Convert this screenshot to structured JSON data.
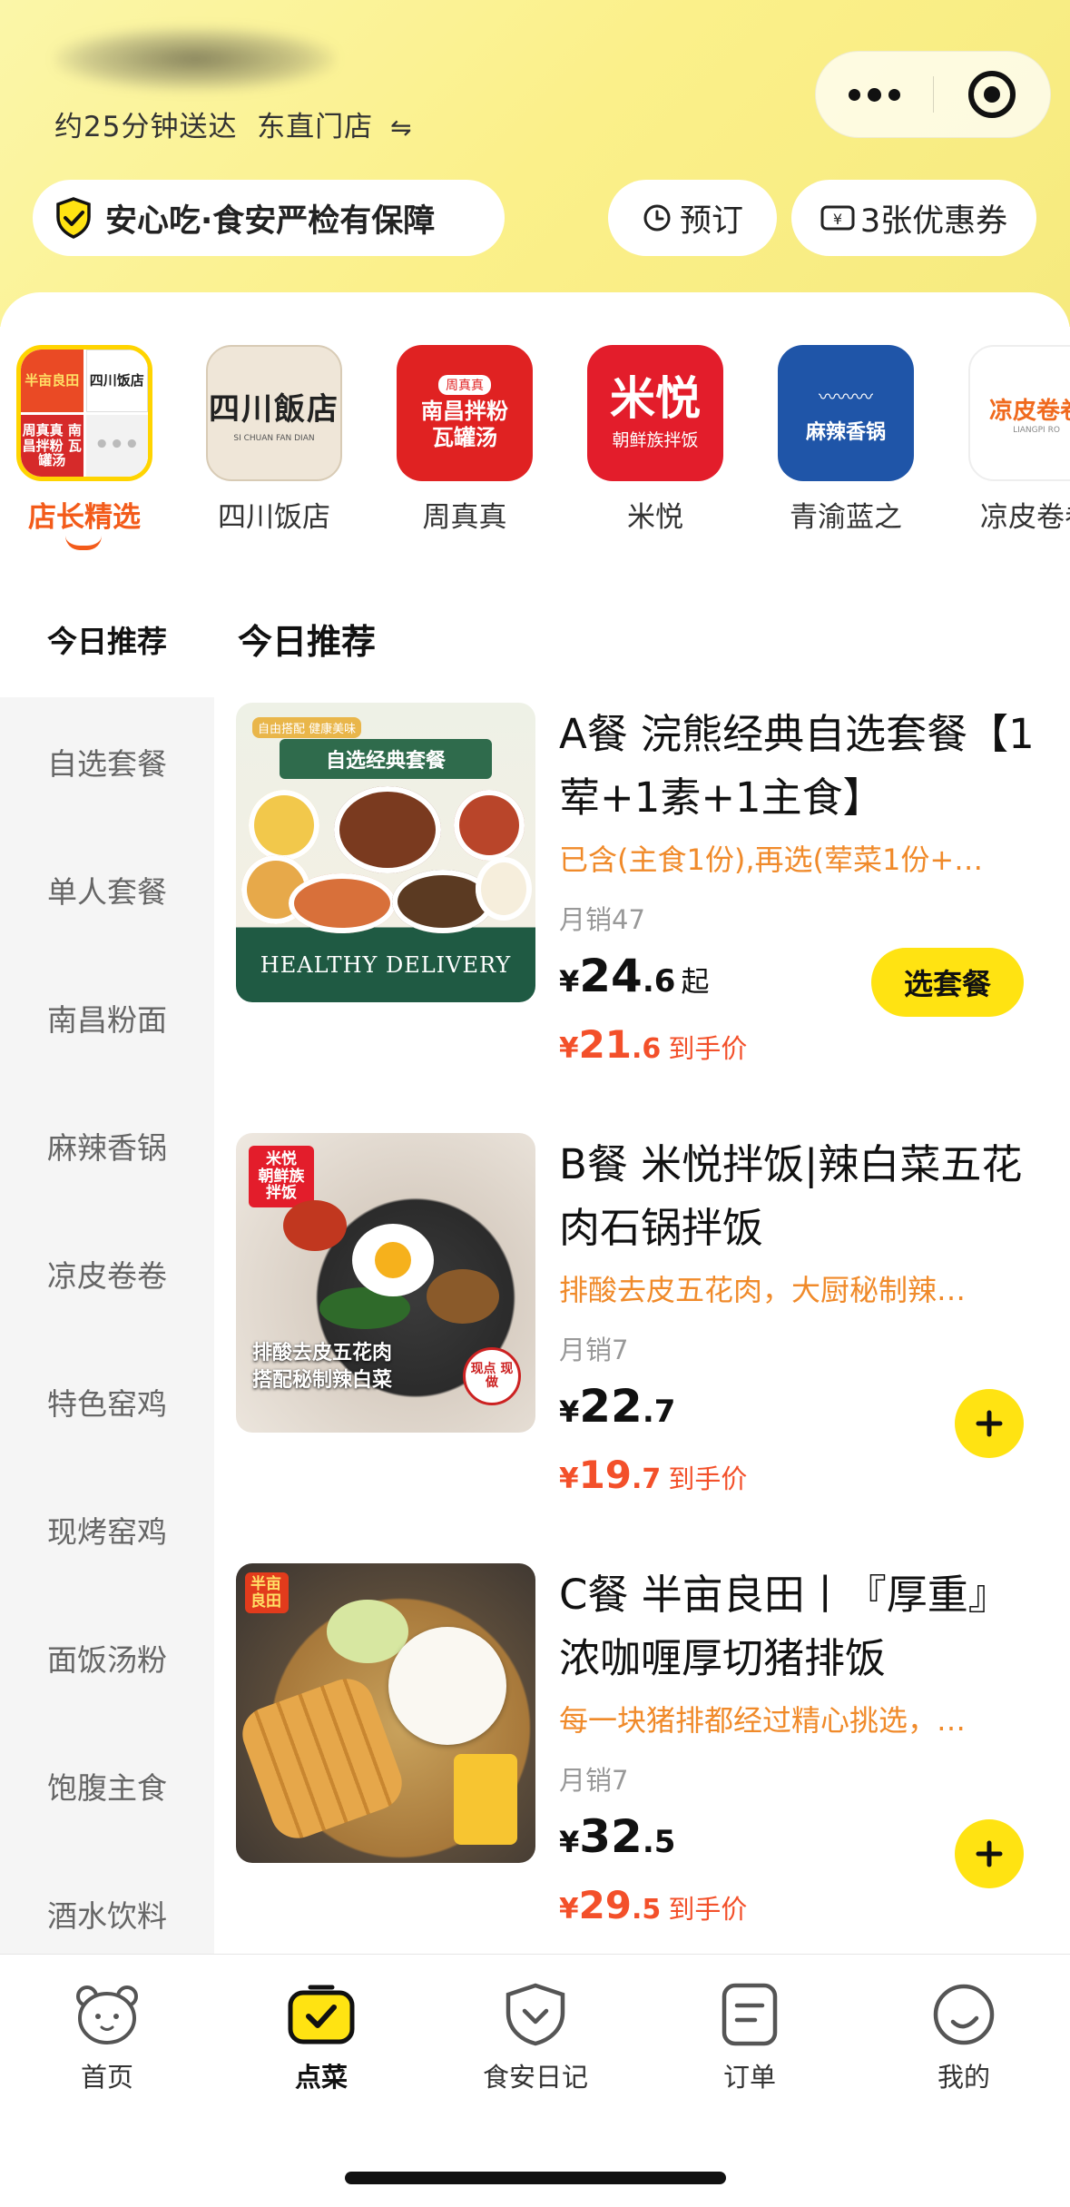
{
  "header": {
    "delivery_info": "约25分钟送达",
    "store_name": "东直门店",
    "switch_symbol": "⇋",
    "safety_label": "安心吃·食安严检有保障",
    "reserve_label": "预订",
    "coupon_label": "3张优惠券"
  },
  "stores": [
    {
      "name": "店长精选",
      "active": true,
      "logo_texts": [
        "半亩良田",
        "四川饭店",
        "周真真 南昌拌粉 瓦罐汤",
        "•••"
      ]
    },
    {
      "name": "四川饭店",
      "logo_main": "四川飯店",
      "logo_sub": "SI CHUAN FAN DIAN"
    },
    {
      "name": "周真真",
      "logo_top": "周真真",
      "logo_main": "南昌拌粉 瓦罐汤"
    },
    {
      "name": "米悦",
      "logo_main": "米悦",
      "logo_sub": "朝鲜族拌饭"
    },
    {
      "name": "青渝蓝之",
      "logo_main": "麻辣香锅"
    },
    {
      "name": "凉皮卷卷",
      "logo_main": "凉皮卷卷",
      "logo_sub": "LIANGPI RO"
    }
  ],
  "sidebar": {
    "active": "今日推荐",
    "categories": [
      "自选套餐",
      "单人套餐",
      "南昌粉面",
      "麻辣香锅",
      "凉皮卷卷",
      "特色窑鸡",
      "现烤窑鸡",
      "面饭汤粉",
      "饱腹主食",
      "酒水饮料"
    ]
  },
  "section_title": "今日推荐",
  "dishes": [
    {
      "title": "A餐 浣熊经典自选套餐【1荤+1素+1主食】",
      "desc": "已含(主食1份),再选(荤菜1份+…",
      "sales": "月销47",
      "price_yen": "¥",
      "price_int": "24",
      "price_dec": ".6",
      "price_suffix": "起",
      "final_yen": "¥",
      "final_int": "21",
      "final_dec": ".6",
      "final_tag": "到手价",
      "action": "选套餐",
      "img_texts": {
        "mini": "自由搭配 健康美味",
        "banner": "自选经典套餐",
        "foot": "HEALTHY DELIVERY"
      }
    },
    {
      "title": "B餐 米悦拌饭|辣白菜五花肉石锅拌饭",
      "desc": "排酸去皮五花肉，大厨秘制辣…",
      "sales": "月销7",
      "price_yen": "¥",
      "price_int": "22",
      "price_dec": ".7",
      "final_yen": "¥",
      "final_int": "19",
      "final_dec": ".7",
      "final_tag": "到手价",
      "img_texts": {
        "brand": "米悦 朝鲜族拌饭",
        "cap1": "排酸去皮五花肉",
        "cap2": "搭配秘制辣白菜",
        "stamp": "现点 现做"
      }
    },
    {
      "title": "C餐 半亩良田丨『厚重』浓咖喱厚切猪排饭",
      "desc": "每一块猪排都经过精心挑选，…",
      "sales": "月销7",
      "price_yen": "¥",
      "price_int": "32",
      "price_dec": ".5",
      "final_yen": "¥",
      "final_int": "29",
      "final_dec": ".5",
      "final_tag": "到手价",
      "img_texts": {
        "brand": "半亩 良田"
      }
    }
  ],
  "bottom_nav": [
    {
      "label": "首页",
      "icon": "bear-face-icon"
    },
    {
      "label": "点菜",
      "icon": "order-food-icon",
      "active": true
    },
    {
      "label": "食安日记",
      "icon": "shield-check-icon"
    },
    {
      "label": "订单",
      "icon": "order-list-icon"
    },
    {
      "label": "我的",
      "icon": "profile-smile-icon"
    }
  ],
  "colors": {
    "accent_yellow": "#ffe312",
    "accent_orange": "#f35b1a",
    "price_red": "#f3502a",
    "desc_orange": "#f08a2a"
  }
}
